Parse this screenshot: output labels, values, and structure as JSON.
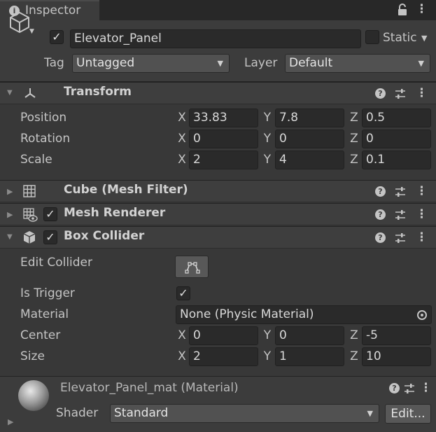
{
  "window": {
    "tab_label": "Inspector"
  },
  "header": {
    "object_name": "Elevator_Panel",
    "static_label": "Static",
    "tag_label": "Tag",
    "tag_value": "Untagged",
    "layer_label": "Layer",
    "layer_value": "Default"
  },
  "transform": {
    "title": "Transform",
    "rows": [
      {
        "label": "Position",
        "x": "33.83",
        "y": "7.8",
        "z": "0.5"
      },
      {
        "label": "Rotation",
        "x": "0",
        "y": "0",
        "z": "0"
      },
      {
        "label": "Scale",
        "x": "2",
        "y": "4",
        "z": "0.1"
      }
    ]
  },
  "mesh_filter": {
    "title": "Cube (Mesh Filter)"
  },
  "mesh_renderer": {
    "title": "Mesh Renderer"
  },
  "box_collider": {
    "title": "Box Collider",
    "edit_collider_label": "Edit Collider",
    "is_trigger_label": "Is Trigger",
    "material_label": "Material",
    "material_value": "None (Physic Material)",
    "center": {
      "label": "Center",
      "x": "0",
      "y": "0",
      "z": "-5"
    },
    "size": {
      "label": "Size",
      "x": "2",
      "y": "1",
      "z": "10"
    }
  },
  "material": {
    "name": "Elevator_Panel_mat (Material)",
    "shader_label": "Shader",
    "shader_value": "Standard",
    "edit_label": "Edit..."
  },
  "axis_labels": {
    "x": "X",
    "y": "Y",
    "z": "Z"
  },
  "icons": [
    "info-icon",
    "lock-icon",
    "kebab-menu-icon",
    "gameobject-cube-icon",
    "transform-icon",
    "mesh-filter-grid-icon",
    "mesh-renderer-icon",
    "box-collider-icon",
    "help-icon",
    "preset-icon",
    "edit-collider-icon",
    "object-picker-icon",
    "checkmark-icon"
  ],
  "colors": {
    "background": "#383838",
    "field": "#2a2a2a",
    "header": "#3e3e3e",
    "text": "#c4c4c4"
  }
}
